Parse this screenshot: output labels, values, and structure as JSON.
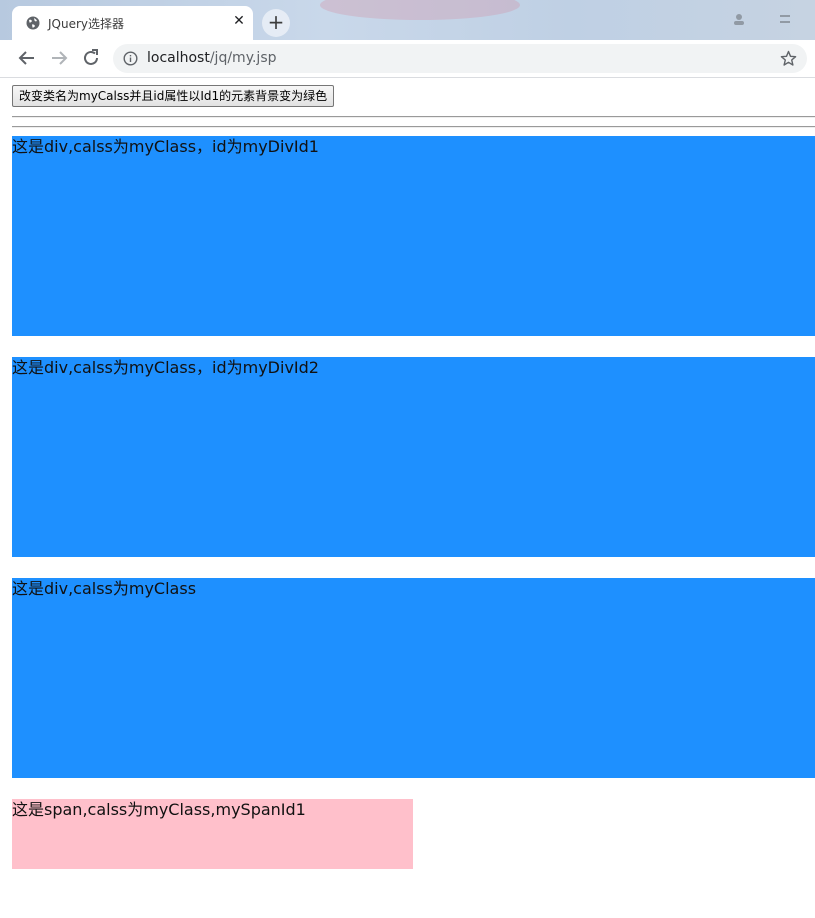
{
  "browser": {
    "tab_title": "JQuery选择器",
    "close_glyph": "✕",
    "new_tab_glyph": "+",
    "url_host": "localhost",
    "url_path": "/jq/my.jsp"
  },
  "page": {
    "button_label": "改变类名为myCalss并且id属性以Id1的元素背景变为绿色",
    "divs": [
      {
        "text": "这是div,calss为myClass，id为myDivId1"
      },
      {
        "text": "这是div,calss为myClass，id为myDivId2"
      },
      {
        "text": "这是div,calss为myClass"
      }
    ],
    "span_text": "这是span,calss为myClass,mySpanId1"
  },
  "colors": {
    "div_background": "#1e90ff",
    "span_background": "#ffc0cb"
  },
  "icons": {
    "tab_favicon": "globe-icon",
    "back": "arrow-left-icon",
    "forward": "arrow-right-icon",
    "reload": "reload-icon",
    "site_info": "info-icon",
    "bookmark": "star-icon"
  }
}
